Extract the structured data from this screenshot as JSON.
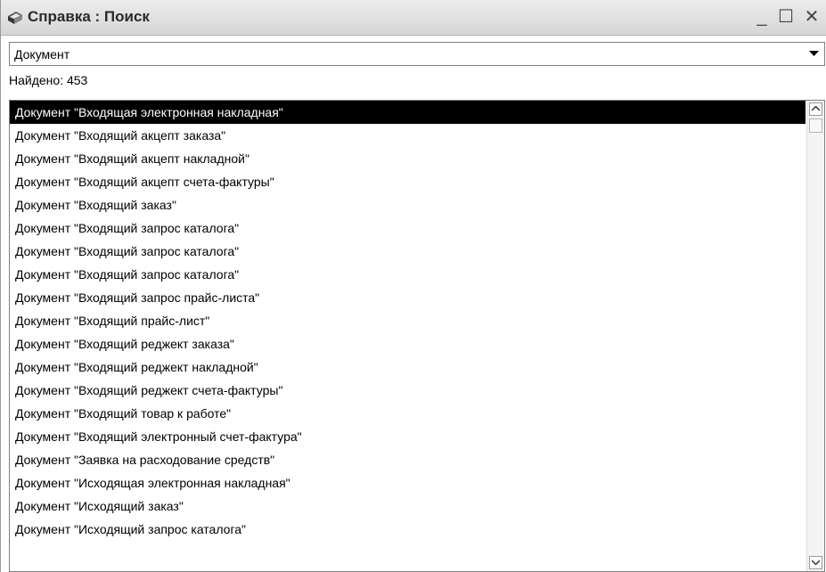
{
  "window": {
    "title": "Справка : Поиск",
    "icon": "book-icon",
    "minimize": "_",
    "maximize": "☐",
    "close": "✕"
  },
  "filter": {
    "selected_value": "Документ"
  },
  "results": {
    "found_label": "Найдено: 453",
    "selected_index": 0,
    "items": [
      "Документ \"Входящая электронная накладная\"",
      "Документ \"Входящий акцепт заказа\"",
      "Документ \"Входящий акцепт накладной\"",
      "Документ \"Входящий акцепт счета-фактуры\"",
      "Документ \"Входящий заказ\"",
      "Документ \"Входящий запрос каталога\"",
      "Документ \"Входящий запрос каталога\"",
      "Документ \"Входящий запрос каталога\"",
      "Документ \"Входящий запрос прайс-листа\"",
      "Документ \"Входящий прайс-лист\"",
      "Документ \"Входящий реджект заказа\"",
      "Документ \"Входящий реджект накладной\"",
      "Документ \"Входящий реджект счета-фактуры\"",
      "Документ \"Входящий товар к работе\"",
      "Документ \"Входящий электронный счет-фактура\"",
      "Документ \"Заявка на расходование средств\"",
      "Документ \"Исходящая электронная накладная\"",
      "Документ \"Исходящий заказ\"",
      "Документ \"Исходящий запрос каталога\""
    ]
  },
  "colors": {
    "selection_bg": "#000000",
    "selection_fg": "#ffffff"
  }
}
